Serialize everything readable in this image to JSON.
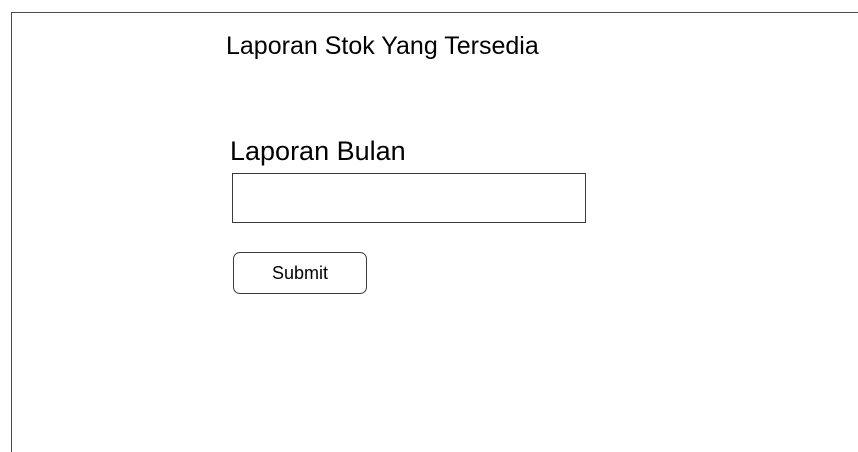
{
  "page": {
    "title": "Laporan Stok Yang Tersedia"
  },
  "form": {
    "month_label": "Laporan Bulan",
    "month_value": "",
    "submit_label": "Submit"
  },
  "colors": {
    "border": "#3a3a3a",
    "background": "#ffffff",
    "text": "#000000"
  }
}
